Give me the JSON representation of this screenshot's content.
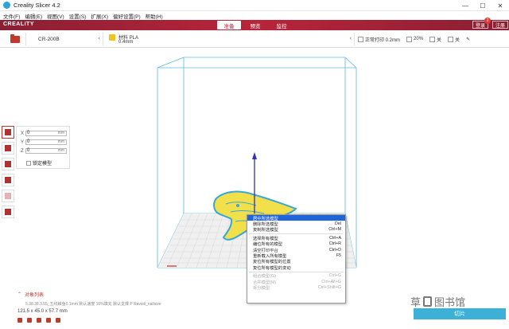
{
  "window": {
    "title": "Creality Slicer 4.2",
    "controls": [
      "—",
      "☐",
      "✕"
    ]
  },
  "menu": [
    "文件(F)",
    "编辑(E)",
    "视图(V)",
    "设置(S)",
    "扩展(X)",
    "偏好设置(P)",
    "帮助(H)"
  ],
  "header": {
    "logo": "CREALITY",
    "tabs": [
      "准备",
      "预览",
      "监控"
    ],
    "active_tab": 0,
    "badge_count": "2",
    "right_buttons": [
      "登录",
      "注册"
    ]
  },
  "toolbar": {
    "printer_name": "CR-200B",
    "material_name": "材料 PLA",
    "material_size": "0.4mm",
    "profile": "正常打印 0.2mm",
    "infill": "20%",
    "support": "关",
    "adhesion": "关"
  },
  "move_panel": {
    "x_label": "X",
    "y_label": "Y",
    "z_label": "Z",
    "x_value": "0",
    "y_value": "0",
    "z_value": "0",
    "unit": "mm",
    "lock_label": "锁定模型"
  },
  "context_menu": {
    "items": [
      {
        "label": "居中所选模型",
        "shortcut": "",
        "state": "highlight"
      },
      {
        "label": "删除所选模型",
        "shortcut": "Del",
        "state": "normal"
      },
      {
        "label": "复制所选模型",
        "shortcut": "Ctrl+M",
        "state": "normal"
      },
      {
        "label": "选择所有模型",
        "shortcut": "Ctrl+A",
        "state": "normal"
      },
      {
        "label": "编位所有的模型",
        "shortcut": "Ctrl+R",
        "state": "normal"
      },
      {
        "label": "清空打印平台",
        "shortcut": "Ctrl+D",
        "state": "normal"
      },
      {
        "label": "重新载入所有模型",
        "shortcut": "F5",
        "state": "normal"
      },
      {
        "label": "复位所有模型的位置",
        "shortcut": "",
        "state": "normal"
      },
      {
        "label": "复位所有模型的变动",
        "shortcut": "",
        "state": "normal"
      },
      {
        "label": "组合模型(G)",
        "shortcut": "Ctrl+G",
        "state": "disabled"
      },
      {
        "label": "合并模型(M)",
        "shortcut": "Ctrl+Alt+G",
        "state": "disabled"
      },
      {
        "label": "拆分模型",
        "shortcut": "Ctrl+Shift+G",
        "state": "disabled"
      }
    ]
  },
  "object_list": {
    "title": "对象列表",
    "object_name": "5.38.38.3.55_五线鳞鱼0.1mm 默认速度 10%填充 默认支撑 P Ravioli_nailsize",
    "dimensions": "121.5 x 45.0 x 57.7 mm"
  },
  "watermark": {
    "left": "草",
    "right": "图书馆"
  },
  "slice_button": "切片",
  "colors": {
    "brand_red": "#b9243a",
    "build_volume": "#5fb7db",
    "model": "#f2e04b",
    "model_outline": "#3aa7d8",
    "slice_blue": "#3cb0d6",
    "menu_highlight": "#1f64d9"
  }
}
